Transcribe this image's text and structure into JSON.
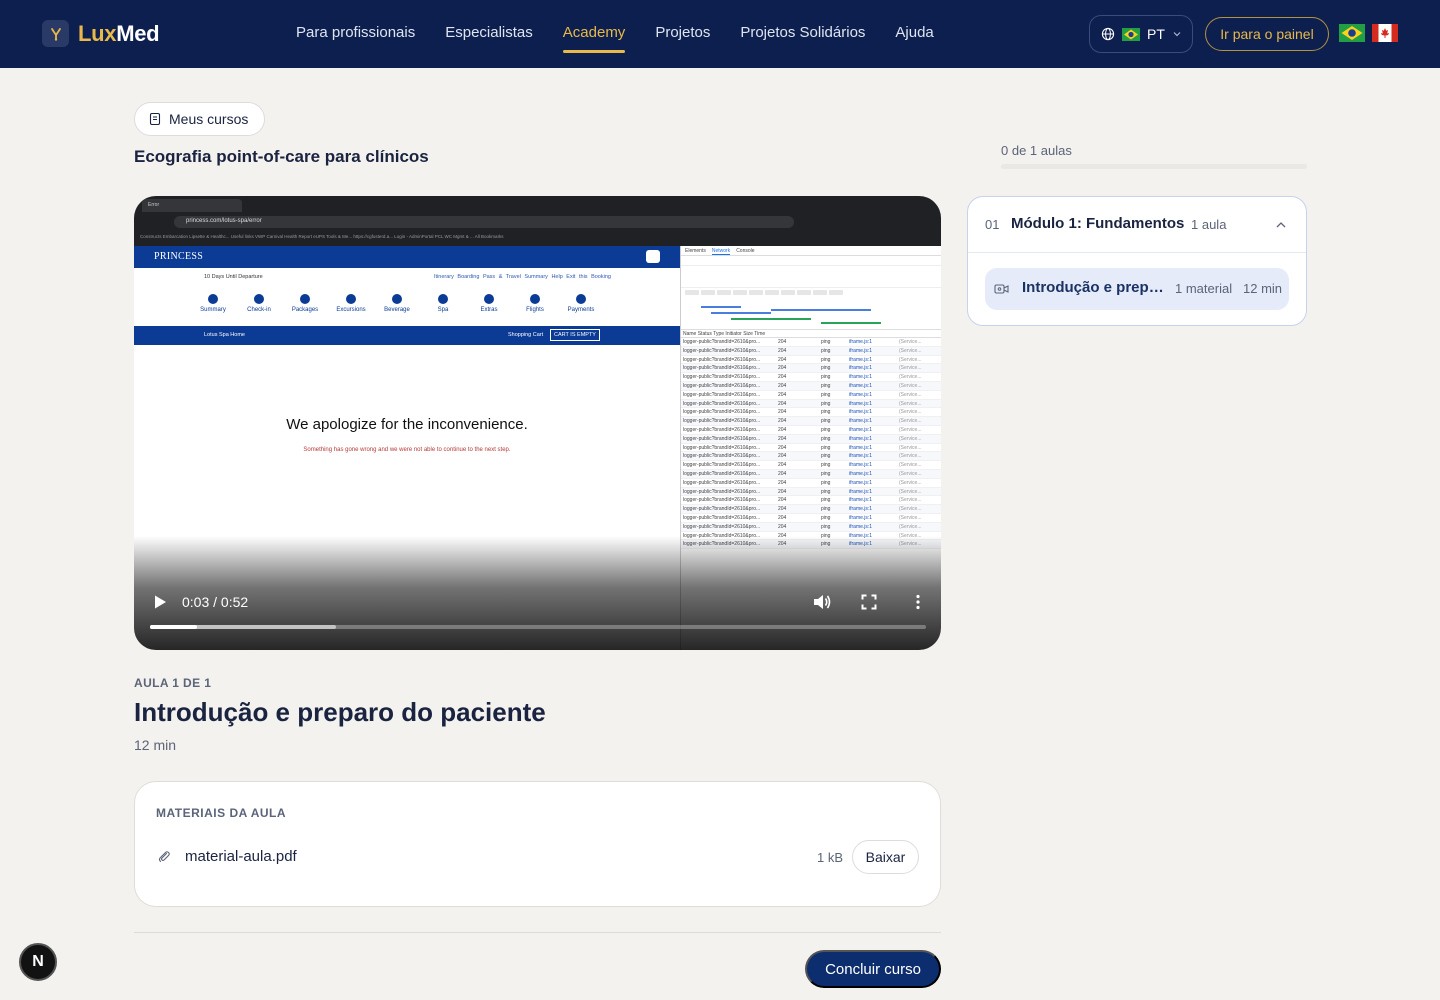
{
  "header": {
    "logo_lux": "Lux",
    "logo_med": "Med",
    "nav": [
      {
        "label": "Para profissionais",
        "active": false
      },
      {
        "label": "Especialistas",
        "active": false
      },
      {
        "label": "Academy",
        "active": true
      },
      {
        "label": "Projetos",
        "active": false
      },
      {
        "label": "Projetos Solidários",
        "active": false
      },
      {
        "label": "Ajuda",
        "active": false
      }
    ],
    "language": "PT",
    "panel_button": "Ir para o painel"
  },
  "course": {
    "back_button": "Meus cursos",
    "title": "Ecografia point-of-care para clínicos"
  },
  "video": {
    "time": "0:03 / 0:52",
    "played_fraction": 0.06,
    "buffered_fraction": 0.24,
    "content": {
      "tab": "Error",
      "url": "princess.com/lotus-spa/error",
      "bookmarks": "Constructs   Embarcation   Lipsette & Healthc...   Useful links   VWP   Carnival   Health Report   eUPS Tools & Me...   https://cgfusterd.a...   Login - AdminPortal   PCL WC Mgmt & ...   All Bookmarks",
      "brand": "PRINCESS",
      "days": "10 Days Until Departure",
      "top_links": "Itinerary  Boarding Pass & Travel Summary  Help  Exit this Booking",
      "icons": [
        "Summary",
        "Check-in",
        "Packages",
        "Excursions",
        "Beverage",
        "Spa",
        "Extras",
        "Flights",
        "Payments"
      ],
      "bar_left": "Lotus Spa Home",
      "bar_right": "Shopping Cart",
      "cart": "CART IS EMPTY",
      "apology": "We apologize for the inconvenience.",
      "apology_sub": "Something has gone wrong and we were not able to continue to the next step.",
      "devtools_tabs": [
        "Elements",
        "Network",
        "Console"
      ],
      "devtools_headers": "Name   Status   Type   Initiator   Size   Time",
      "row_name": "logger-public?brandId=2610&pro...",
      "row_status": "204",
      "row_type": "ping",
      "row_initiator": "iframe.js:1",
      "row_size": "(Service..."
    }
  },
  "lesson": {
    "kicker": "AULA 1 DE 1",
    "title": "Introdução e preparo do paciente",
    "duration": "12 min"
  },
  "materials": {
    "label": "MATERIAIS DA AULA",
    "items": [
      {
        "name": "material-aula.pdf",
        "size": "1 kB",
        "action": "Baixar"
      }
    ]
  },
  "finish_button": "Concluir curso",
  "sidebar": {
    "progress_text": "0 de 1 aulas",
    "progress_fraction": 0,
    "modules": [
      {
        "number": "01",
        "title": "Módulo 1: Fundamentos",
        "count": "1 aula",
        "lessons": [
          {
            "title": "Introdução e preparo do paciente",
            "materials": "1 material",
            "duration": "12 min"
          }
        ]
      }
    ]
  },
  "colors": {
    "nav_bg": "#0c1f4f",
    "accent_gold": "#e8b94a",
    "primary_blue": "#0c2d6e",
    "page_bg": "#f4f2ee"
  },
  "dev_badge": "N"
}
